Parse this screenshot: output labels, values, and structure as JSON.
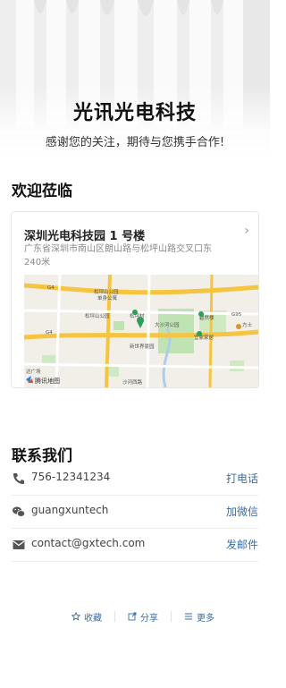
{
  "hero": {
    "title": "光讯光电科技",
    "subtitle": "感谢您的关注，期待与您携手合作!"
  },
  "welcome": {
    "heading": "欢迎莅临",
    "location": {
      "name": "深圳光电科技园 1 号楼",
      "address": "广东省深圳市南山区朗山路与松坪山路交叉口东240米"
    },
    "map": {
      "labels": [
        "G4",
        "松坪山公园",
        "单身公寓",
        "松坪山公园",
        "松坪村",
        "大沙河公园",
        "碧然楼",
        "宜家家居",
        "方士",
        "新世界豪园",
        "达广场",
        "G4",
        "G95",
        "沙河西路"
      ],
      "logo_text": "腾讯地图"
    }
  },
  "contact": {
    "heading": "联系我们",
    "rows": [
      {
        "icon": "phone-icon",
        "text": "756-12341234",
        "action": "打电话"
      },
      {
        "icon": "wechat-icon",
        "text": "guangxuntech",
        "action": "加微信"
      },
      {
        "icon": "mail-icon",
        "text": "contact@gxtech.com",
        "action": "发邮件"
      }
    ]
  },
  "footer": {
    "items": [
      {
        "icon": "star-icon",
        "label": "收藏"
      },
      {
        "icon": "share-icon",
        "label": "分享"
      },
      {
        "icon": "menu-icon",
        "label": "更多"
      }
    ]
  },
  "colors": {
    "accent": "#3a6ea5",
    "map_road": "#f5c542",
    "map_green": "#bfe3b2",
    "map_water": "#aecde8"
  }
}
